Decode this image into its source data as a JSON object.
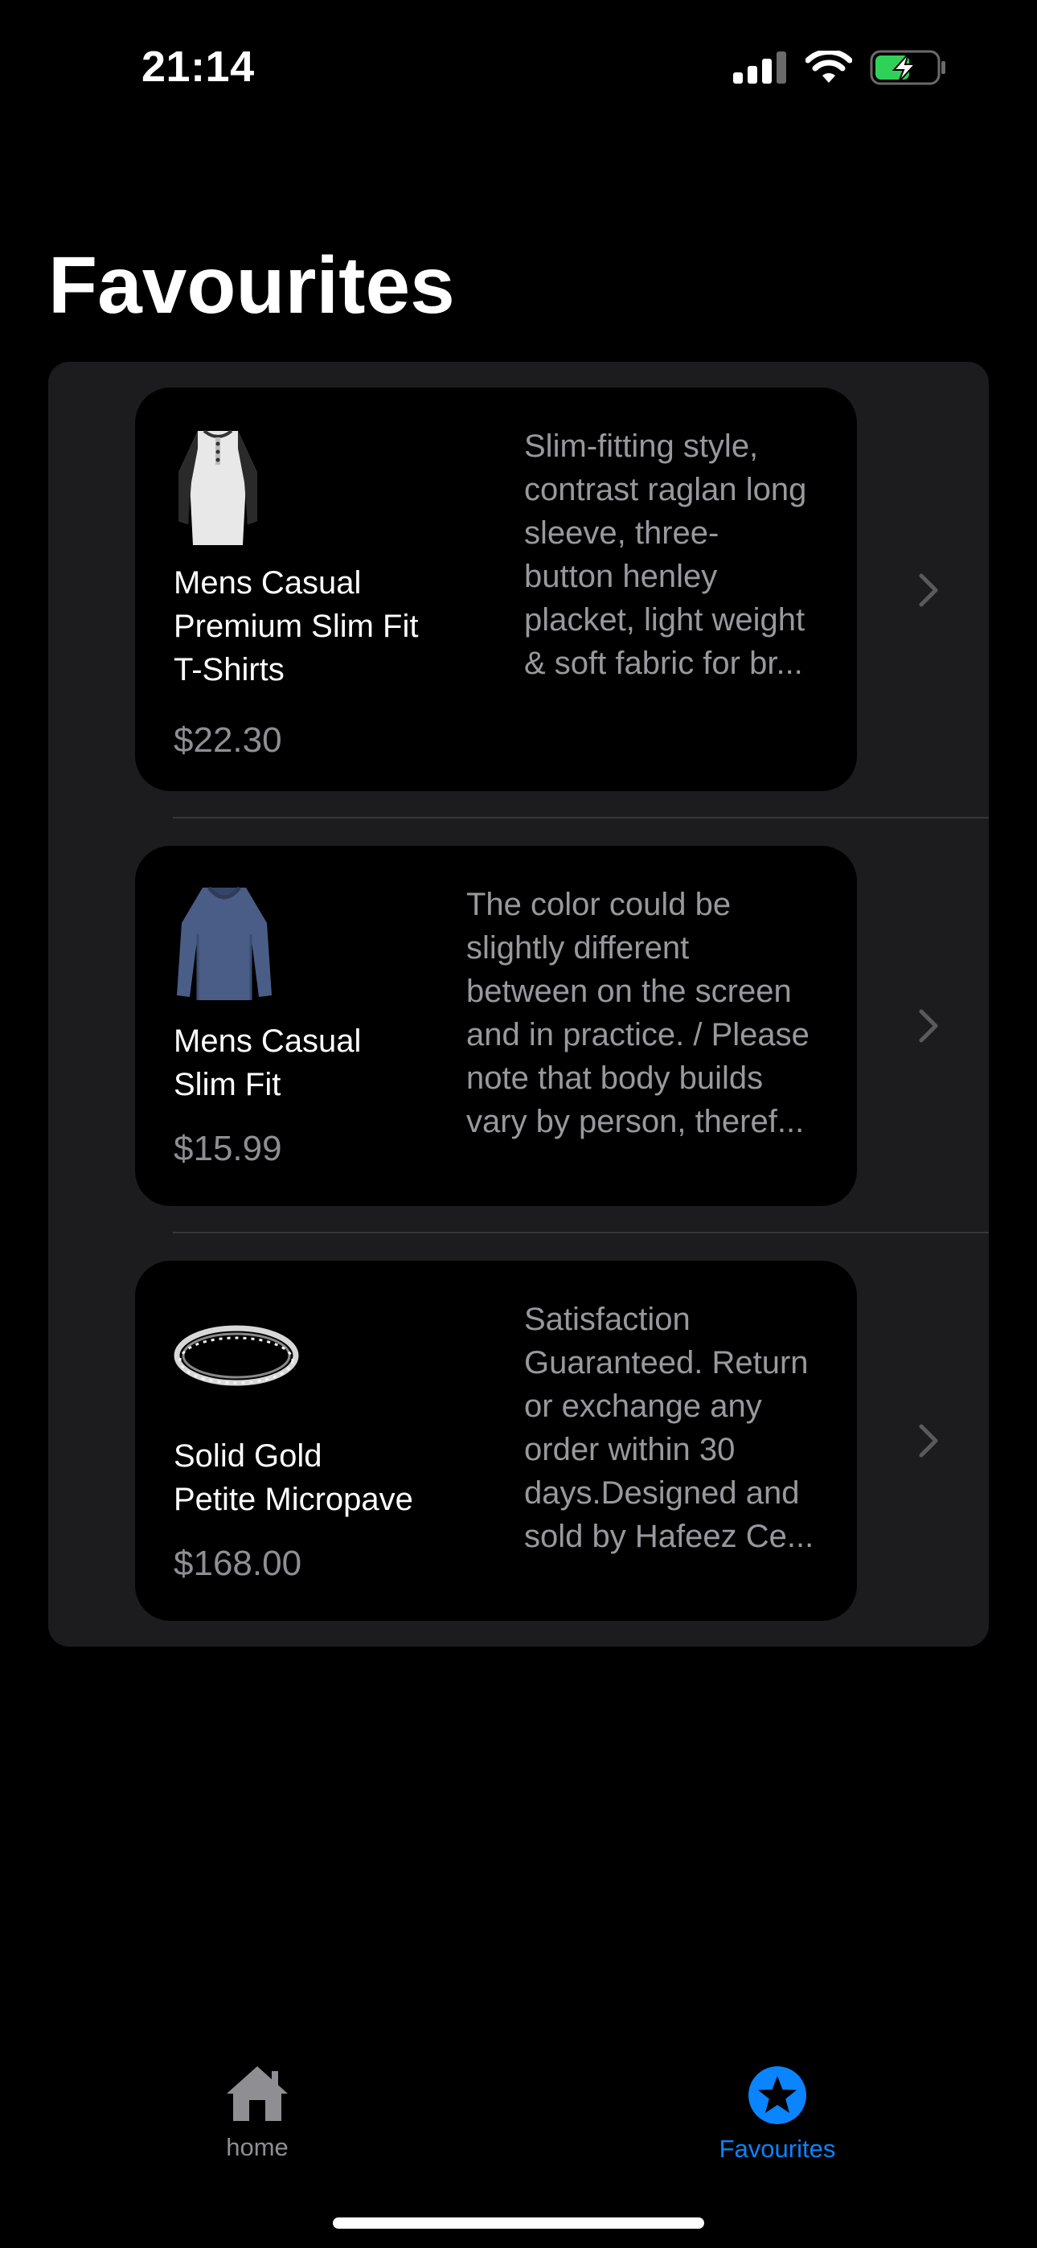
{
  "status_bar": {
    "time": "21:14",
    "icons": [
      "cellular-signal-icon",
      "wifi-icon",
      "battery-charging-icon"
    ]
  },
  "page": {
    "title": "Favourites"
  },
  "favourites": [
    {
      "title": "Mens Casual Premium Slim Fit T-Shirts",
      "title_lines": [
        "Mens Casual",
        "Premium Slim Fit",
        "T-Shirts"
      ],
      "price": "$22.30",
      "description_lines": [
        "Slim-fitting style,",
        "contrast raglan long",
        "sleeve, three-",
        "button henley",
        "placket, light weight",
        "& soft fabric for br..."
      ],
      "image_icon": "raglan-henley-shirt-image"
    },
    {
      "title": "Mens Casual Slim Fit",
      "title_lines": [
        "Mens Casual",
        "Slim Fit"
      ],
      "price": "$15.99",
      "description_lines": [
        "The color could be",
        "slightly different",
        "between on the screen",
        "and in practice. / Please",
        "note that body builds",
        "vary by person, theref..."
      ],
      "image_icon": "blue-long-sleeve-shirt-image"
    },
    {
      "title": "Solid Gold Petite Micropave",
      "title_lines": [
        "Solid Gold",
        "Petite Micropave"
      ],
      "price": "$168.00",
      "description_lines": [
        "Satisfaction",
        "Guaranteed. Return",
        "or exchange any",
        "order within 30",
        "days.Designed and",
        "sold by Hafeez Ce..."
      ],
      "image_icon": "silver-ring-image"
    }
  ],
  "tab_bar": {
    "tabs": [
      {
        "label": "home",
        "icon": "house-icon",
        "selected": false
      },
      {
        "label": "Favourites",
        "icon": "star-circle-icon",
        "selected": true
      }
    ],
    "colors": {
      "selected": "#0a84ff",
      "unselected": "#8e8e93"
    }
  }
}
